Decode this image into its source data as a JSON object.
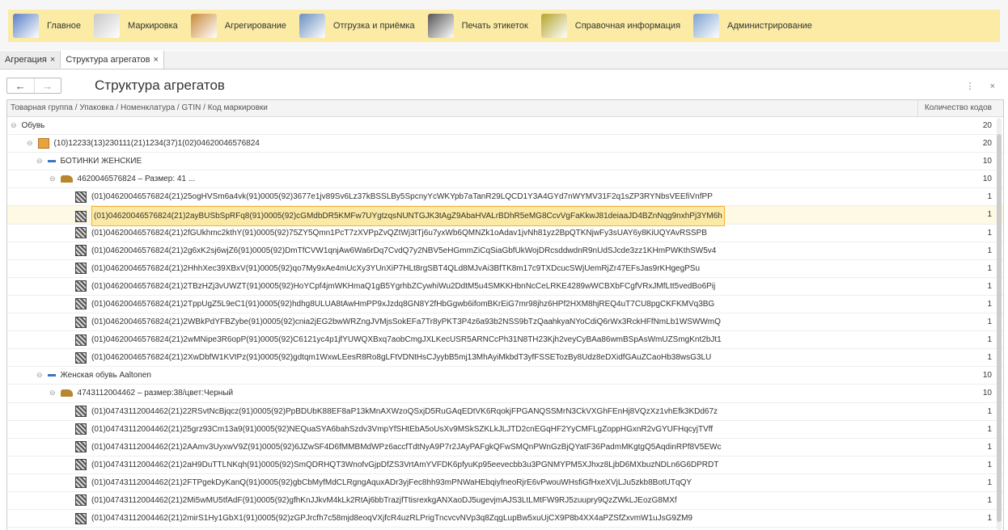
{
  "nav": [
    {
      "label": "Главное",
      "icon": "home-icon"
    },
    {
      "label": "Маркировка",
      "icon": "checklist-icon"
    },
    {
      "label": "Агрегирование",
      "icon": "box-icon"
    },
    {
      "label": "Отгрузка и приёмка",
      "icon": "truck-icon"
    },
    {
      "label": "Печать этикеток",
      "icon": "printer-icon"
    },
    {
      "label": "Справочная информация",
      "icon": "books-icon"
    },
    {
      "label": "Администрирование",
      "icon": "computer-icon"
    }
  ],
  "tabs": [
    {
      "label": "Агрегация",
      "close": "×"
    },
    {
      "label": "Структура агрегатов",
      "close": "×"
    }
  ],
  "title": "Структура агрегатов",
  "window_icons": "⋮ ×",
  "nav_buttons": {
    "back": "←",
    "forward": "→"
  },
  "columns": {
    "tree": "Товарная группа / Упаковка / Номенклатура / GTIN / Код маркировки",
    "count": "Количество кодов"
  },
  "rows": [
    {
      "level": 0,
      "icon": "none",
      "toggle": "⊖",
      "text": "Обувь",
      "count": "20"
    },
    {
      "level": 1,
      "icon": "box",
      "toggle": "⊖",
      "text": "(10)12233(13)230111(21)1234(37)1(02)04620046576824",
      "count": "20"
    },
    {
      "level": 2,
      "icon": "dash",
      "toggle": "⊖",
      "text": "БОТИНКИ ЖЕНСКИЕ",
      "count": "10"
    },
    {
      "level": 3,
      "icon": "shoe",
      "toggle": "⊖",
      "text": "4620046576824 – Размер: 41 ...",
      "count": "10"
    },
    {
      "level": 4,
      "icon": "qr",
      "toggle": "",
      "text": "(01)04620046576824(21)25ogHVSm6a4vk(91)0005(92)3677e1jv89Sv6Lz37kBSSLBy5SpcnyYcWKYpb7aTanR29LQCD1Y3A4GYd7nWYMV31F2q1sZP3RYNbsVEEfiVnfPP",
      "count": "1"
    },
    {
      "level": 4,
      "icon": "qr",
      "toggle": "",
      "text": "(01)04620046576824(21)2ayBUSbSpRFq8(91)0005(92)cGMdbDR5KMFw7UYgtzqsNUNTGJK3tAgZ9AbaHVALrBDhR5eMG8CcvVgFaKkwJ81deiaaJD4BZnNqg9nxhPj3YM6h",
      "count": "1",
      "selected": true
    },
    {
      "level": 4,
      "icon": "qr",
      "toggle": "",
      "text": "(01)04620046576824(21)2fGUkhmc2kthY(91)0005(92)75ZY5Qmn1PcT7zXVPpZvQZtWj3tTj6u7yxWb6QMNZk1oAdav1jvNh81yz2BpQTKNjwFy3sUAY6y8KiUQYAvRSSPB",
      "count": "1"
    },
    {
      "level": 4,
      "icon": "qr",
      "toggle": "",
      "text": "(01)04620046576824(21)2g6xK2sj6wjZ6(91)0005(92)DmTfCVW1qnjAw6Wa6rDq7CvdQ7y2NBV5eHGmmZiCqSiaGbfUkWojDRcsddwdnR9nUdSJcde3zz1KHmPWKthSW5v4",
      "count": "1"
    },
    {
      "level": 4,
      "icon": "qr",
      "toggle": "",
      "text": "(01)04620046576824(21)2HhhXec39XBxV(91)0005(92)qo7My9xAe4mUcXy3YUnXiP7HLt8rgSBT4QLd8MJvAi3BfTK8m17c9TXDcucSWjUemRjZr47EFsJas9rKHgegPSu",
      "count": "1"
    },
    {
      "level": 4,
      "icon": "qr",
      "toggle": "",
      "text": "(01)04620046576824(21)2TBzHZj3vUWZT(91)0005(92)HoYCpf4jmWKHmaQ1gB5YgrhbZCywhiWu2DdtM5u4SMKKHbnNcCeLRKE4289wWCBXbFCgfVRxJMfLtt5vedBo6Pij",
      "count": "1"
    },
    {
      "level": 4,
      "icon": "qr",
      "toggle": "",
      "text": "(01)04620046576824(21)2TppUgZ5L9eC1(91)0005(92)hdhg8ULUA8tAwHmPP9xJzdq8GN8Y2fHbGgwb6ifomBKrEiG7mr98jhz6HPf2HXM8hjREQ4uT7CU8pgCKFKMVq3BG",
      "count": "1"
    },
    {
      "level": 4,
      "icon": "qr",
      "toggle": "",
      "text": "(01)04620046576824(21)2WBkPdYFBZybe(91)0005(92)cnia2jEG2bwWRZngJVMjsSokEFa7Tr8yPKT3P4z6a93b2NSS9bTzQaahkyaNYoCdiQ6rWx3RckHFfNmLb1WSWWmQ",
      "count": "1"
    },
    {
      "level": 4,
      "icon": "qr",
      "toggle": "",
      "text": "(01)04620046576824(21)2wMNipe3R6opP(91)0005(92)C6121yc4p1jfYUWQXBxq7aobCmgJXLKecUSR5ARNCcPh31N8TH23Kjh2veyCyBAa86wmBSpAsWmUZSmgKnt2bJt1",
      "count": "1"
    },
    {
      "level": 4,
      "icon": "qr",
      "toggle": "",
      "text": "(01)04620046576824(21)2XwDbfW1KVtPz(91)0005(92)gdtqm1WxwLEesR8Ro8gLFtVDNtHsCJyybB5mj13MhAyiMkbdT3yfFSSETozBy8Udz8eDXidfGAuZCaoHb38wsG3LU",
      "count": "1"
    },
    {
      "level": 2,
      "icon": "dash",
      "toggle": "⊖",
      "text": "Женская обувь Aaltonen",
      "count": "10"
    },
    {
      "level": 3,
      "icon": "shoe",
      "toggle": "⊖",
      "text": "4743112004462 – размер:38/цвет:Черный",
      "count": "10"
    },
    {
      "level": 4,
      "icon": "qr",
      "toggle": "",
      "text": "(01)04743112004462(21)22RSvtNcBjqcz(91)0005(92)PpBDUbK88EF8aP13kMnAXWzoQSxjD5RuGAqEDtVK6RqokjFPGANQSSMrN3CkVXGhFEnHj8VQzXz1vhEfk3KDd67z",
      "count": "1"
    },
    {
      "level": 4,
      "icon": "qr",
      "toggle": "",
      "text": "(01)04743112004462(21)25grz93Cm13a9(91)0005(92)NEQuaSYA6bahSzdv3VmpYfSHtEbA5oUsXv9MSkSZKLkJLJTD2cnEGqHF2YyCMFLgZoppHGxnR2vGYUFHqcyjTVff",
      "count": "1"
    },
    {
      "level": 4,
      "icon": "qr",
      "toggle": "",
      "text": "(01)04743112004462(21)2AAmv3UyxwV9Z(91)0005(92)6JZwSF4D6fMMBMdWPz6accfTdtNyA9P7r2JAyPAFgkQFwSMQnPWnGzBjQYatF36PadmMKgtgQ5AqdinRPf8V5EWc",
      "count": "1"
    },
    {
      "level": 4,
      "icon": "qr",
      "toggle": "",
      "text": "(01)04743112004462(21)2aH9DuTTLNKqh(91)0005(92)SmQDRHQT3WnofvGjpDfZS3VrtAmYVFDK6pfyuKp95eevecbb3u3PGNMYPM5XJhxz8LjbD6MXbuzNDLn6G6DPRDT",
      "count": "1"
    },
    {
      "level": 4,
      "icon": "qr",
      "toggle": "",
      "text": "(01)04743112004462(21)2FTPgekDyKanQ(91)0005(92)gbCbMyfMdCLRgngAquxADr3yjFec8hh93mPNWaHEbqiyfneoRjrE6vPwouWHsfiGfHxeXVjLJu5zkb8BotUTqQY",
      "count": "1"
    },
    {
      "level": 4,
      "icon": "qr",
      "toggle": "",
      "text": "(01)04743112004462(21)2Mi5wMU5tfAdF(91)0005(92)gfhKnJJkvM4kLk2RtAj6bbTrazjfTtisrexkgANXaoDJ5ugevjmAJS3LtLMtFW9RJ5zuupry9QzZWkLJEozG8MXf",
      "count": "1"
    },
    {
      "level": 4,
      "icon": "qr",
      "toggle": "",
      "text": "(01)04743112004462(21)2mirS1Hy1GbX1(91)0005(92)zGPJrcfh7c58mjd8eoqVXjfcR4uzRLPrigTncvcvNVp3q8ZqgLupBw5xuUjCX9P8b4XX4aPZSfZxvmW1uJsG9ZM9",
      "count": "1"
    },
    {
      "level": 4,
      "icon": "qr",
      "toggle": "",
      "text": "(01)04743112004462(21)2nqUqdiCFznXc(91)0005(92)wfR25vZEUc24SYC5DeRZm5iCXmnbK1jbWiL83bcTZTvmpXHnzq2FYd2VCYCFfqok2WZX7PiWJnYp3w5QU5v1rXy",
      "count": "1"
    }
  ]
}
